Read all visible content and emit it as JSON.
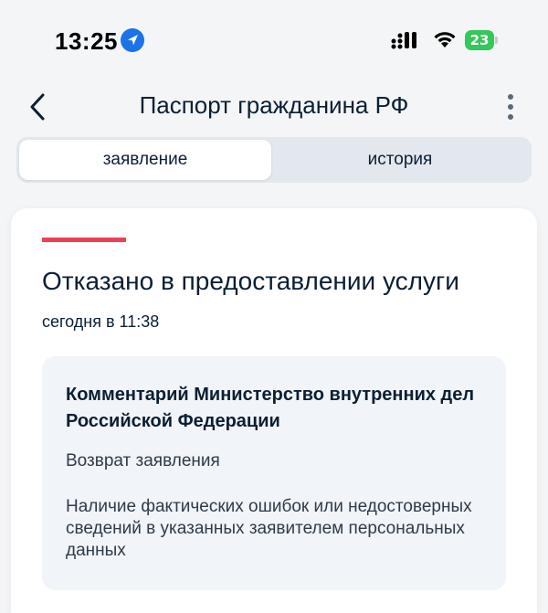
{
  "status_bar": {
    "time": "13:25",
    "battery_level": "23",
    "icons": [
      "location-icon",
      "signal-icon",
      "wifi-icon",
      "battery-icon"
    ]
  },
  "header": {
    "title": "Паспорт гражданина РФ",
    "icons": [
      "back-icon",
      "more-icon"
    ]
  },
  "tabs": [
    {
      "label": "заявление",
      "active": true
    },
    {
      "label": "история",
      "active": false
    }
  ],
  "card": {
    "status_title": "Отказано в предоставлении услуги",
    "date": "сегодня в 11:38",
    "accent_color": "#ee3f58",
    "comment": {
      "heading": "Комментарий Министерство внутренних дел Российской Федерации",
      "action": "Возврат заявления",
      "reason": "Наличие фактических ошибок или недостоверных сведений в указанных заявителем персональных данных"
    }
  },
  "colors": {
    "background": "#f4f5f7",
    "text": "#0b1f33",
    "battery": "#34c759",
    "location": "#1a73e8"
  }
}
